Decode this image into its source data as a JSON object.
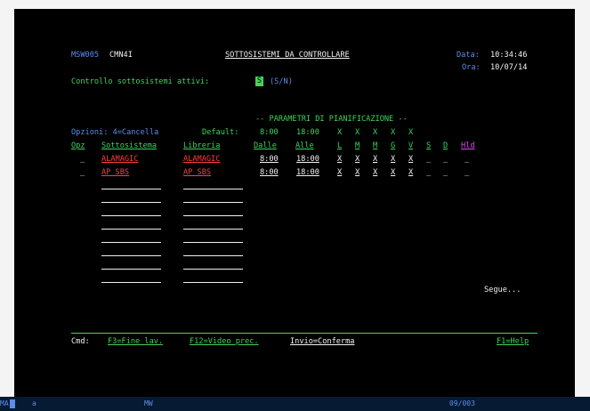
{
  "header": {
    "program_id": "MSW005",
    "system_name": "CMN4I",
    "title": "SOTTOSISTEMI DA CONTROLLARE",
    "data_label": "Data:",
    "data_value": "10:34:46",
    "ora_label": "Ora:",
    "ora_value": "10/07/14"
  },
  "control": {
    "label": "Controllo sottosistemi attivi:",
    "value": "S",
    "hint": "(S/N)"
  },
  "options": {
    "label": "Opzioni: 4=Cancella",
    "default_label": "Default:",
    "params_title": "-- PARAMETRI DI PIANIFICAZIONE --",
    "default_dalle": "8:00",
    "default_alle": "18:00",
    "default_days": [
      "X",
      "X",
      "X",
      "X",
      "X"
    ]
  },
  "columns": {
    "opz": "Opz",
    "sottosistema": "Sottosistema",
    "libreria": "Libreria",
    "dalle": "Dalle",
    "alle": "Alle",
    "l": "L",
    "m1": "M",
    "m2": "M",
    "g": "G",
    "v": "V",
    "s": "S",
    "d": "D",
    "hld": "Hld"
  },
  "rows": [
    {
      "opz": "_",
      "sottosistema": "ALAMAGIC",
      "libreria": "ALAMAGIC",
      "dalle": "8:00",
      "alle": "18:00",
      "l": "X",
      "m1": "X",
      "m2": "X",
      "g": "X",
      "v": "X",
      "s": "_",
      "d": "_",
      "hld": "_"
    },
    {
      "opz": "_",
      "sottosistema": "AP_SBS",
      "libreria": "AP_SBS",
      "dalle": "8:00",
      "alle": "18:00",
      "l": "X",
      "m1": "X",
      "m2": "X",
      "g": "X",
      "v": "X",
      "s": "_",
      "d": "_",
      "hld": "_"
    }
  ],
  "more_indicator": "Segue...",
  "command_bar": {
    "label": "Cmd:",
    "f3": "F3=Fine lav.",
    "f12": "F12=Video prec.",
    "enter": "Invio=Conferma",
    "f1": "F1=Help"
  },
  "status_bar": {
    "left": "MA",
    "session": "a",
    "mode": "MW",
    "position": "09/003"
  }
}
